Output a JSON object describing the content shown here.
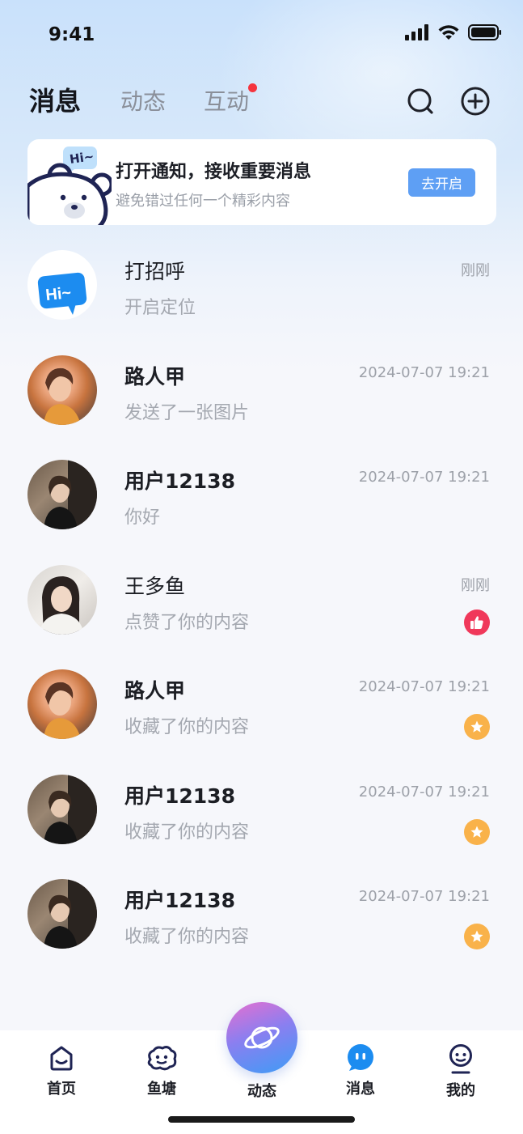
{
  "status_bar": {
    "time": "9:41"
  },
  "header": {
    "tabs": [
      {
        "label": "消息",
        "active": true
      },
      {
        "label": "动态",
        "active": false
      },
      {
        "label": "互动",
        "active": false,
        "has_dot": true
      }
    ],
    "icons": [
      "search-icon",
      "add-circle-icon"
    ]
  },
  "banner": {
    "title": "打开通知，接收重要消息",
    "subtitle": "避免错过任何一个精彩内容",
    "button": "去开启",
    "mascot_text": "Hi~"
  },
  "messages": [
    {
      "name": "打招呼",
      "message": "开启定位",
      "time": "刚刚",
      "avatar": "hi-bubble",
      "badge": null
    },
    {
      "name": "路人甲",
      "message": "发送了一张图片",
      "time": "2024-07-07 19:21",
      "avatar": "photo-1",
      "badge": null
    },
    {
      "name": "用户12138",
      "message": "你好",
      "time": "2024-07-07 19:21",
      "avatar": "photo-2",
      "badge": null
    },
    {
      "name": "王多鱼",
      "message": "点赞了你的内容",
      "time": "刚刚",
      "avatar": "photo-3",
      "badge": "like"
    },
    {
      "name": "路人甲",
      "message": "收藏了你的内容",
      "time": "2024-07-07 19:21",
      "avatar": "photo-1",
      "badge": "star"
    },
    {
      "name": "用户12138",
      "message": "收藏了你的内容",
      "time": "2024-07-07 19:21",
      "avatar": "photo-2",
      "badge": "star"
    },
    {
      "name": "用户12138",
      "message": "收藏了你的内容",
      "time": "2024-07-07 19:21",
      "avatar": "photo-2",
      "badge": "star"
    }
  ],
  "bottom_nav": {
    "items": [
      {
        "label": "首页",
        "icon": "home-icon"
      },
      {
        "label": "鱼塘",
        "icon": "pond-icon"
      },
      {
        "label": "动态",
        "icon": "planet-icon"
      },
      {
        "label": "消息",
        "icon": "message-icon",
        "active": true
      },
      {
        "label": "我的",
        "icon": "profile-icon"
      }
    ]
  },
  "colors": {
    "accent_blue": "#5e9ff4",
    "like_red": "#f0385a",
    "star_orange": "#f9b24a",
    "dot_red": "#f5343e"
  }
}
